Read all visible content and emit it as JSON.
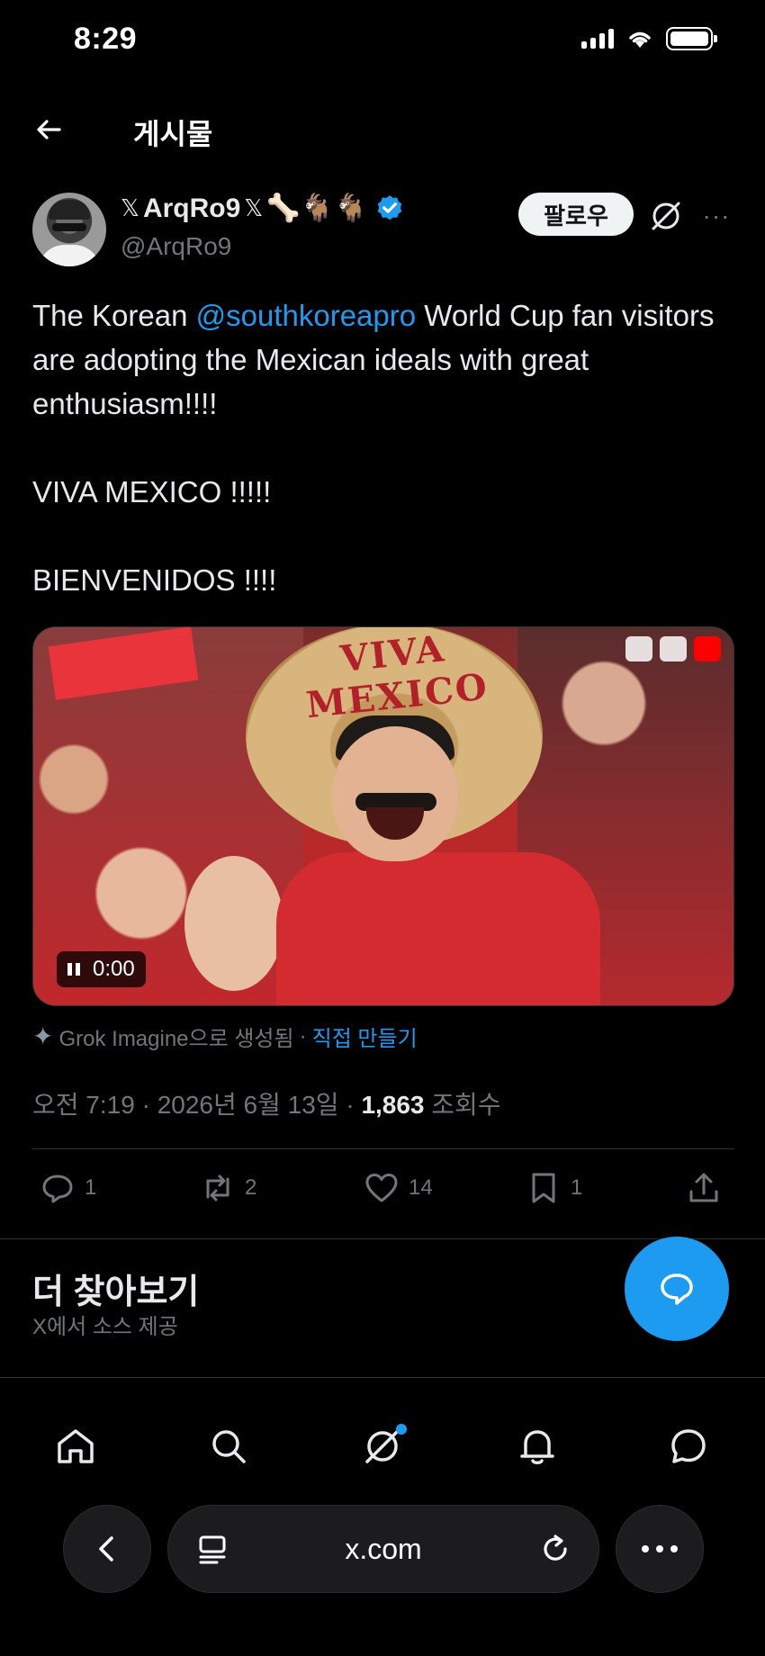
{
  "status_bar": {
    "time": "8:29"
  },
  "header": {
    "title": "게시물"
  },
  "author": {
    "display_name": "ArqRo9",
    "prefix_glyph": "𝕏",
    "suffix_glyph": "𝕏",
    "emojis": "🦴🐐🐐",
    "handle": "@ArqRo9",
    "verified_color": "#1d9bf0"
  },
  "actions_top": {
    "follow_label": "팔로우",
    "more_label": "···"
  },
  "tweet": {
    "text_before_mention": "The Korean ",
    "mention": "@southkoreapro",
    "text_after_mention": " World Cup fan visitors are adopting the Mexican ideals with great enthusiasm!!!!",
    "line_viva": "VIVA MEXICO !!!!!",
    "line_bienvenidos": "BIENVENIDOS !!!!"
  },
  "media": {
    "sombrero_text": "VIVA MEXICO",
    "video_time": "0:00",
    "state": "playing"
  },
  "grok": {
    "label": "Grok Imagine으로 생성됨",
    "separator": "·",
    "link": "직접 만들기"
  },
  "meta": {
    "time": "오전 7:19",
    "date": "2026년 6월 13일",
    "views": "1,863",
    "views_label": "조회수"
  },
  "engagement": {
    "replies": "1",
    "reposts": "2",
    "likes": "14",
    "bookmarks": "1"
  },
  "more_section": {
    "title": "더 찾아보기",
    "subtitle": "X에서 소스 제공"
  },
  "browser": {
    "url": "x.com"
  },
  "colors": {
    "accent": "#1d9bf0",
    "background": "#000000",
    "secondary_text": "#71767b"
  }
}
